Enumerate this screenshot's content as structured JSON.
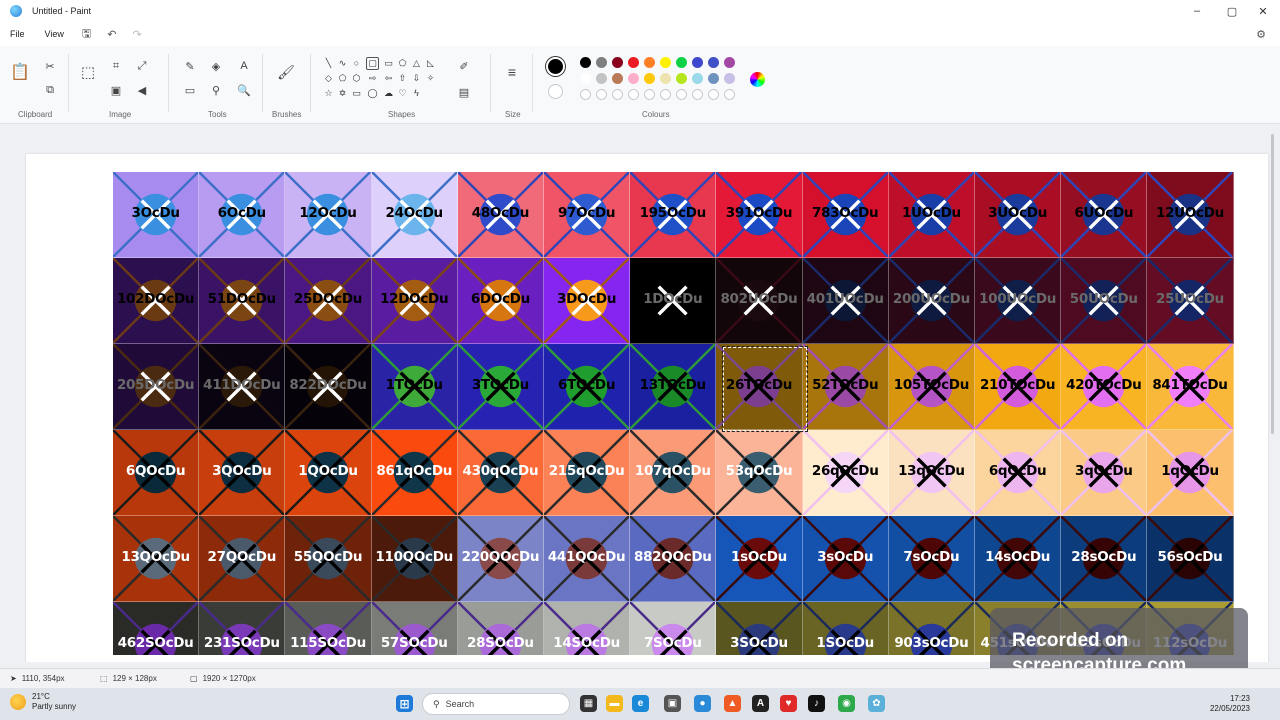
{
  "window": {
    "title": "Untitled - Paint",
    "minimize": "–",
    "maximize": "▢",
    "close": "✕"
  },
  "menu": {
    "file": "File",
    "view": "View"
  },
  "ribbon": {
    "groups": {
      "clipboard": "Clipboard",
      "image": "Image",
      "tools": "Tools",
      "brushes": "Brushes",
      "shapes": "Shapes",
      "size": "Size",
      "colours": "Colours"
    },
    "palette_row1": [
      "#000000",
      "#7f7f7f",
      "#88001b",
      "#ec1c24",
      "#ff7f27",
      "#fff200",
      "#0ed145",
      "#3f48cc",
      "#4051c7",
      "#a349a4"
    ],
    "palette_row2": [
      "#ffffff",
      "#c3c3c3",
      "#b97a57",
      "#ffaec9",
      "#ffc90e",
      "#efe4b0",
      "#b5e61d",
      "#99d9ea",
      "#7092be",
      "#c8bfe7"
    ],
    "primary_color": "#000000",
    "secondary_color": "#ffffff"
  },
  "grid": {
    "rows": [
      [
        {
          "label": "3OcDu",
          "bg": "#a78bef",
          "circle": "#3b8fe0",
          "line": "#3d6fc9",
          "xc": "#ffffff",
          "tc": "#000000"
        },
        {
          "label": "6OcDu",
          "bg": "#b79cf2",
          "circle": "#3b8fe0",
          "line": "#3d6fc9",
          "xc": "#ffffff",
          "tc": "#000000"
        },
        {
          "label": "12OcDu",
          "bg": "#c9b3f5",
          "circle": "#3b8fe0",
          "line": "#3d6fc9",
          "xc": "#ffffff",
          "tc": "#000000"
        },
        {
          "label": "24OcDu",
          "bg": "#ddd0fa",
          "circle": "#6cb4ec",
          "line": "#3d6fc9",
          "xc": "#ffffff",
          "tc": "#000000"
        },
        {
          "label": "48OcDu",
          "bg": "#f06a79",
          "circle": "#2f4bc9",
          "line": "#2f45b9",
          "xc": "#ffffff",
          "tc": "#000000"
        },
        {
          "label": "97OcDu",
          "bg": "#ef5566",
          "circle": "#2e5bd0",
          "line": "#2f45b9",
          "xc": "#ffffff",
          "tc": "#000000"
        },
        {
          "label": "195OcDu",
          "bg": "#e8384f",
          "circle": "#1f50c8",
          "line": "#2f45b9",
          "xc": "#ffffff",
          "tc": "#000000"
        },
        {
          "label": "391OcDu",
          "bg": "#e31937",
          "circle": "#1b4ac4",
          "line": "#2f45b9",
          "xc": "#ffffff",
          "tc": "#000000"
        },
        {
          "label": "783OcDu",
          "bg": "#d4102c",
          "circle": "#1a44b8",
          "line": "#2f45b9",
          "xc": "#ffffff",
          "tc": "#000000"
        },
        {
          "label": "1UOcDu",
          "bg": "#bd0f2a",
          "circle": "#1a3ea8",
          "line": "#2f45b9",
          "xc": "#ffffff",
          "tc": "#000000"
        },
        {
          "label": "3UOcDu",
          "bg": "#a90e25",
          "circle": "#1a3a9c",
          "line": "#2f45b9",
          "xc": "#ffffff",
          "tc": "#000000"
        },
        {
          "label": "6UOcDu",
          "bg": "#950e22",
          "circle": "#1a3690",
          "line": "#2f45b9",
          "xc": "#ffffff",
          "tc": "#000000"
        },
        {
          "label": "12UOcDu",
          "bg": "#7f0c1d",
          "circle": "#1a3286",
          "line": "#2f45b9",
          "xc": "#ffffff",
          "tc": "#000000"
        }
      ],
      [
        {
          "label": "102DOcDu",
          "bg": "#2c0f4e",
          "circle": "#6a3b12",
          "line": "#6b3a16",
          "xc": "#ffffff",
          "tc": "#000000"
        },
        {
          "label": "51DOcDu",
          "bg": "#3a1266",
          "circle": "#7a4512",
          "line": "#6b3a16",
          "xc": "#ffffff",
          "tc": "#000000"
        },
        {
          "label": "25DOcDu",
          "bg": "#4a1783",
          "circle": "#8a4e12",
          "line": "#6b3a16",
          "xc": "#ffffff",
          "tc": "#000000"
        },
        {
          "label": "12DOcDu",
          "bg": "#5a1ca0",
          "circle": "#a45c10",
          "line": "#7b4414",
          "xc": "#ffffff",
          "tc": "#000000"
        },
        {
          "label": "6DOcDu",
          "bg": "#6a20c0",
          "circle": "#d6760f",
          "line": "#8b4c12",
          "xc": "#ffffff",
          "tc": "#000000"
        },
        {
          "label": "3DOcDu",
          "bg": "#8526f0",
          "circle": "#f79a1c",
          "line": "#a05a10",
          "xc": "#ffffff",
          "tc": "#000000"
        },
        {
          "label": "1DOcDu",
          "bg": "#000000",
          "circle": "#000000",
          "line": "#000000",
          "xc": "#ffffff",
          "tc": "#6a6a6a"
        },
        {
          "label": "802UOcDu",
          "bg": "#12060a",
          "circle": "#1a0a10",
          "line": "#3a0a14",
          "xc": "#ffffff",
          "tc": "#6a6a6a"
        },
        {
          "label": "401UOcDu",
          "bg": "#1e0612",
          "circle": "#0c1736",
          "line": "#1a2a6a",
          "xc": "#ffffff",
          "tc": "#6a6a6a"
        },
        {
          "label": "200UOcDu",
          "bg": "#2a0816",
          "circle": "#0e1a40",
          "line": "#1a2a6a",
          "xc": "#ffffff",
          "tc": "#6a6a6a"
        },
        {
          "label": "100UOcDu",
          "bg": "#3a0a1c",
          "circle": "#101e4a",
          "line": "#1a2a6a",
          "xc": "#ffffff",
          "tc": "#6a6a6a"
        },
        {
          "label": "50UOcDu",
          "bg": "#4e0a20",
          "circle": "#122258",
          "line": "#1a2a6a",
          "xc": "#ffffff",
          "tc": "#6a6a6a"
        },
        {
          "label": "25UOcDu",
          "bg": "#640c24",
          "circle": "#142666",
          "line": "#1a2a6a",
          "xc": "#ffffff",
          "tc": "#6a6a6a"
        }
      ],
      [
        {
          "label": "205DOcDu",
          "bg": "#200b38",
          "circle": "#4a2a10",
          "line": "#4a2a10",
          "xc": "#ffffff",
          "tc": "#6a6a6a"
        },
        {
          "label": "411DOcDu",
          "bg": "#0a0410",
          "circle": "#2a1808",
          "line": "#3a2210",
          "xc": "#ffffff",
          "tc": "#6a6a6a"
        },
        {
          "label": "822DOcDu",
          "bg": "#05020a",
          "circle": "#241406",
          "line": "#3a2210",
          "xc": "#ffffff",
          "tc": "#6a6a6a"
        },
        {
          "label": "1TOcDu",
          "bg": "#2a23a6",
          "circle": "#3eaa3a",
          "line": "#2e9a3a",
          "xc": "#000000",
          "tc": "#000000"
        },
        {
          "label": "3TOcDu",
          "bg": "#2722b2",
          "circle": "#2aa838",
          "line": "#2e9a3a",
          "xc": "#000000",
          "tc": "#000000"
        },
        {
          "label": "6TOcDu",
          "bg": "#1f22ac",
          "circle": "#1f9d2e",
          "line": "#2e9a3a",
          "xc": "#000000",
          "tc": "#000000"
        },
        {
          "label": "13TOcDu",
          "bg": "#1a20a0",
          "circle": "#1a8a28",
          "line": "#2e9a3a",
          "xc": "#000000",
          "tc": "#000000"
        },
        {
          "label": "26TOcDu",
          "bg": "#7e5a0a",
          "circle": "#7c3e8e",
          "line": "#7c4a8e",
          "xc": "#000000",
          "tc": "#000000"
        },
        {
          "label": "52TOcDu",
          "bg": "#a8750c",
          "circle": "#9a4aa4",
          "line": "#a050b0",
          "xc": "#000000",
          "tc": "#000000"
        },
        {
          "label": "105TOcDu",
          "bg": "#d8960e",
          "circle": "#b554c4",
          "line": "#c060d0",
          "xc": "#000000",
          "tc": "#000000"
        },
        {
          "label": "210TOcDu",
          "bg": "#f2a810",
          "circle": "#d25cdc",
          "line": "#d066e0",
          "xc": "#000000",
          "tc": "#000000"
        },
        {
          "label": "420TOcDu",
          "bg": "#f8b422",
          "circle": "#e46ef0",
          "line": "#e070f0",
          "xc": "#000000",
          "tc": "#000000"
        },
        {
          "label": "841TOcDu",
          "bg": "#fab83a",
          "circle": "#f07ef8",
          "line": "#e880f8",
          "xc": "#000000",
          "tc": "#000000"
        }
      ],
      [
        {
          "label": "6QOcDu",
          "bg": "#b8380c",
          "circle": "#0a2a3a",
          "line": "#1a1a1a",
          "xc": "#000000",
          "tc": "#ffffff"
        },
        {
          "label": "3QOcDu",
          "bg": "#c83e0c",
          "circle": "#0c2e40",
          "line": "#1a1a1a",
          "xc": "#000000",
          "tc": "#ffffff"
        },
        {
          "label": "1QOcDu",
          "bg": "#dc440e",
          "circle": "#0e3246",
          "line": "#1a1a1a",
          "xc": "#000000",
          "tc": "#ffffff"
        },
        {
          "label": "861qOcDu",
          "bg": "#fb4a0e",
          "circle": "#10364a",
          "line": "#2a2a2a",
          "xc": "#000000",
          "tc": "#ffffff"
        },
        {
          "label": "430qOcDu",
          "bg": "#fb6a36",
          "circle": "#1a4054",
          "line": "#2a2a2a",
          "xc": "#000000",
          "tc": "#ffffff"
        },
        {
          "label": "215qOcDu",
          "bg": "#fb8256",
          "circle": "#22485c",
          "line": "#2a2a2a",
          "xc": "#000000",
          "tc": "#ffffff"
        },
        {
          "label": "107qOcDu",
          "bg": "#fb9a76",
          "circle": "#2a5264",
          "line": "#2a2a2a",
          "xc": "#000000",
          "tc": "#ffffff"
        },
        {
          "label": "53qOcDu",
          "bg": "#fbb498",
          "circle": "#3a5e70",
          "line": "#2a2a2a",
          "xc": "#000000",
          "tc": "#ffffff"
        },
        {
          "label": "26qOcDu",
          "bg": "#ffeccf",
          "circle": "#f6d6f6",
          "line": "#f0c0f0",
          "xc": "#000000",
          "tc": "#000000"
        },
        {
          "label": "13qOcDu",
          "bg": "#fbe1c0",
          "circle": "#f2c6f2",
          "line": "#f0c0f0",
          "xc": "#000000",
          "tc": "#000000"
        },
        {
          "label": "6qOcDu",
          "bg": "#fbd49e",
          "circle": "#eeb6ee",
          "line": "#f0c0f0",
          "xc": "#000000",
          "tc": "#000000"
        },
        {
          "label": "3qOcDu",
          "bg": "#fbca86",
          "circle": "#eaa6ea",
          "line": "#f0c0f0",
          "xc": "#000000",
          "tc": "#000000"
        },
        {
          "label": "1qOcDu",
          "bg": "#fbbf6e",
          "circle": "#e696e6",
          "line": "#f0c0f0",
          "xc": "#000000",
          "tc": "#000000"
        }
      ],
      [
        {
          "label": "13QOcDu",
          "bg": "#a8320a",
          "circle": "#5a6a7a",
          "line": "#2a2a2a",
          "xc": "#000000",
          "tc": "#ffffff"
        },
        {
          "label": "27QOcDu",
          "bg": "#8c2a0a",
          "circle": "#4a5a6a",
          "line": "#2a2a2a",
          "xc": "#000000",
          "tc": "#ffffff"
        },
        {
          "label": "55QOcDu",
          "bg": "#6e220a",
          "circle": "#3a4a5a",
          "line": "#2a2a2a",
          "xc": "#000000",
          "tc": "#ffffff"
        },
        {
          "label": "110QOcDu",
          "bg": "#4c1a0a",
          "circle": "#2a3a4a",
          "line": "#2a2a2a",
          "xc": "#000000",
          "tc": "#ffffff"
        },
        {
          "label": "220QOcDu",
          "bg": "#7c84c8",
          "circle": "#8a4a4a",
          "line": "#2a2a2a",
          "xc": "#000000",
          "tc": "#ffffff"
        },
        {
          "label": "441QOcDu",
          "bg": "#6a76c4",
          "circle": "#7a3a3a",
          "line": "#2a2a2a",
          "xc": "#000000",
          "tc": "#ffffff"
        },
        {
          "label": "882QOcDu",
          "bg": "#5a6ac0",
          "circle": "#6a2a2a",
          "line": "#2a2a2a",
          "xc": "#000000",
          "tc": "#ffffff"
        },
        {
          "label": "1sOcDu",
          "bg": "#1656b8",
          "circle": "#6a0a0a",
          "line": "#3a0a0a",
          "xc": "#000000",
          "tc": "#ffffff"
        },
        {
          "label": "3sOcDu",
          "bg": "#1452ae",
          "circle": "#5a0808",
          "line": "#3a0a0a",
          "xc": "#000000",
          "tc": "#ffffff"
        },
        {
          "label": "7sOcDu",
          "bg": "#124ea2",
          "circle": "#4e0606",
          "line": "#3a0a0a",
          "xc": "#000000",
          "tc": "#ffffff"
        },
        {
          "label": "14sOcDu",
          "bg": "#0f4690",
          "circle": "#420606",
          "line": "#3a0a0a",
          "xc": "#000000",
          "tc": "#ffffff"
        },
        {
          "label": "28sOcDu",
          "bg": "#0d3c7c",
          "circle": "#360404",
          "line": "#3a0a0a",
          "xc": "#000000",
          "tc": "#ffffff"
        },
        {
          "label": "56sOcDu",
          "bg": "#0a3268",
          "circle": "#2a0404",
          "line": "#3a0a0a",
          "xc": "#000000",
          "tc": "#ffffff"
        }
      ],
      [
        {
          "label": "462SOcDu",
          "bg": "#2a2a26",
          "circle": "#6a2aa8",
          "line": "#4a2a8a",
          "xc": "#000000",
          "tc": "#ffffff"
        },
        {
          "label": "231SOcDu",
          "bg": "#3a3c38",
          "circle": "#7a3ab8",
          "line": "#4a2a8a",
          "xc": "#000000",
          "tc": "#ffffff"
        },
        {
          "label": "115SOcDu",
          "bg": "#5a5c58",
          "circle": "#8a4ac4",
          "line": "#4a2a8a",
          "xc": "#000000",
          "tc": "#ffffff"
        },
        {
          "label": "57SOcDu",
          "bg": "#7a7c78",
          "circle": "#9a5ace",
          "line": "#4a2a8a",
          "xc": "#000000",
          "tc": "#ffffff"
        },
        {
          "label": "28SOcDu",
          "bg": "#9a9c98",
          "circle": "#aa6ad8",
          "line": "#4a2a8a",
          "xc": "#000000",
          "tc": "#ffffff"
        },
        {
          "label": "14SOcDu",
          "bg": "#b0b2ae",
          "circle": "#ba7ae2",
          "line": "#4a2a8a",
          "xc": "#000000",
          "tc": "#ffffff"
        },
        {
          "label": "7SOcDu",
          "bg": "#c8cac6",
          "circle": "#ca8aec",
          "line": "#4a2a8a",
          "xc": "#000000",
          "tc": "#ffffff"
        },
        {
          "label": "3SOcDu",
          "bg": "#5a5620",
          "circle": "#2a3a7a",
          "line": "#1a2a5a",
          "xc": "#000000",
          "tc": "#ffffff"
        },
        {
          "label": "1SOcDu",
          "bg": "#6a6424",
          "circle": "#2a3a8a",
          "line": "#1a2a5a",
          "xc": "#000000",
          "tc": "#ffffff"
        },
        {
          "label": "903sOcDu",
          "bg": "#7a7228",
          "circle": "#2a3a9a",
          "line": "#1a2a5a",
          "xc": "#000000",
          "tc": "#ffffff"
        },
        {
          "label": "451sOcDu",
          "bg": "#8a802c",
          "circle": "#2a3aaa",
          "line": "#1a2a5a",
          "xc": "#000000",
          "tc": "#ffffff"
        },
        {
          "label": "225sOcDu",
          "bg": "#9a8e30",
          "circle": "#2a3aba",
          "line": "#1a2a5a",
          "xc": "#000000",
          "tc": "#ffffff"
        },
        {
          "label": "112sOcDu",
          "bg": "#aa9c34",
          "circle": "#2a3aca",
          "line": "#1a2a5a",
          "xc": "#000000",
          "tc": "#ffffff"
        }
      ]
    ]
  },
  "watermark": {
    "line1": "Recorded on",
    "line2": "screencapture.com"
  },
  "status": {
    "cursor": "1110, 354px",
    "selection": "129 × 128px",
    "canvas_size": "1920 × 1270px"
  },
  "taskbar": {
    "weather_temp": "21°C",
    "weather_desc": "Partly sunny",
    "search_placeholder": "Search",
    "time": "17:23",
    "date": "22/05/2023"
  }
}
